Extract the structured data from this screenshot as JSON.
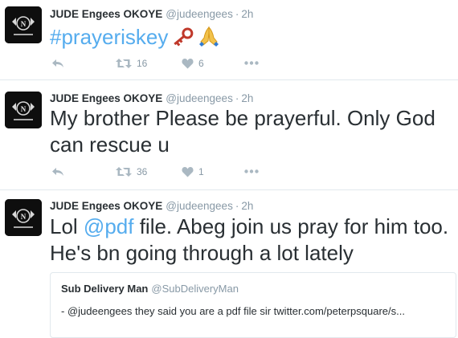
{
  "colors": {
    "accent": "#55acee",
    "muted": "#8899a6",
    "text": "#292f33",
    "key": "#c0392b"
  },
  "tweets": [
    {
      "name": "JUDE Engees OKOYE",
      "handle": "@judeengees",
      "separator": "·",
      "time": "2h",
      "hashtag": "#prayeriskey",
      "emoji": "🔑🙏",
      "retweets": "16",
      "likes": "6",
      "icons": [
        "reply-icon",
        "retweet-icon",
        "heart-icon",
        "more-icon"
      ]
    },
    {
      "name": "JUDE Engees OKOYE",
      "handle": "@judeengees",
      "separator": "·",
      "time": "2h",
      "text": "My brother Please be prayerful. Only God can rescue u",
      "retweets": "36",
      "likes": "1"
    },
    {
      "name": "JUDE Engees OKOYE",
      "handle": "@judeengees",
      "separator": "·",
      "time": "2h",
      "text_before": "Lol ",
      "mention": "@pdf",
      "text_after": " file. Abeg join us pray for him too. He's bn going through a lot lately",
      "quote": {
        "name": "Sub Delivery Man",
        "handle": "@SubDeliveryMan",
        "text": "- @judeengees they said you are a pdf file sir  twitter.com/peterpsquare/s..."
      }
    }
  ]
}
